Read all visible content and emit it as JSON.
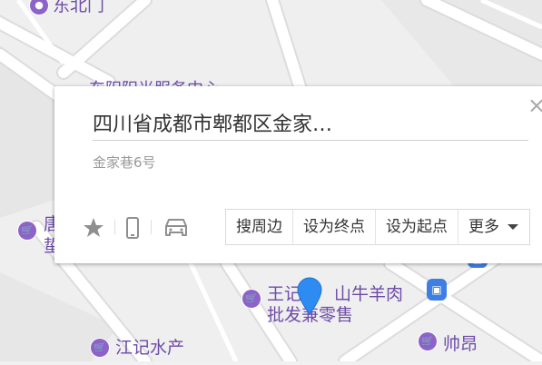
{
  "map": {
    "pois": [
      {
        "id": "dongbeimen",
        "label": "东北门"
      },
      {
        "id": "service_center",
        "label": "东阳阳光服务中心"
      },
      {
        "id": "left_partial",
        "label": "唐\n蜇"
      },
      {
        "id": "wangji_top",
        "label": "王记"
      },
      {
        "id": "wangji_rest",
        "label": "山牛羊肉"
      },
      {
        "id": "wangji_line2",
        "label": "批发兼零售"
      },
      {
        "id": "jiangji",
        "label": "江记水产"
      },
      {
        "id": "shuaiang",
        "label": "帅昂"
      }
    ]
  },
  "popup": {
    "title": "四川省成都市郫都区金家…",
    "address": "金家巷6号",
    "close_label": "×",
    "tools": [
      "star-icon",
      "phone-icon",
      "car-icon"
    ],
    "actions": [
      "搜周边",
      "设为终点",
      "设为起点",
      "更多"
    ]
  }
}
